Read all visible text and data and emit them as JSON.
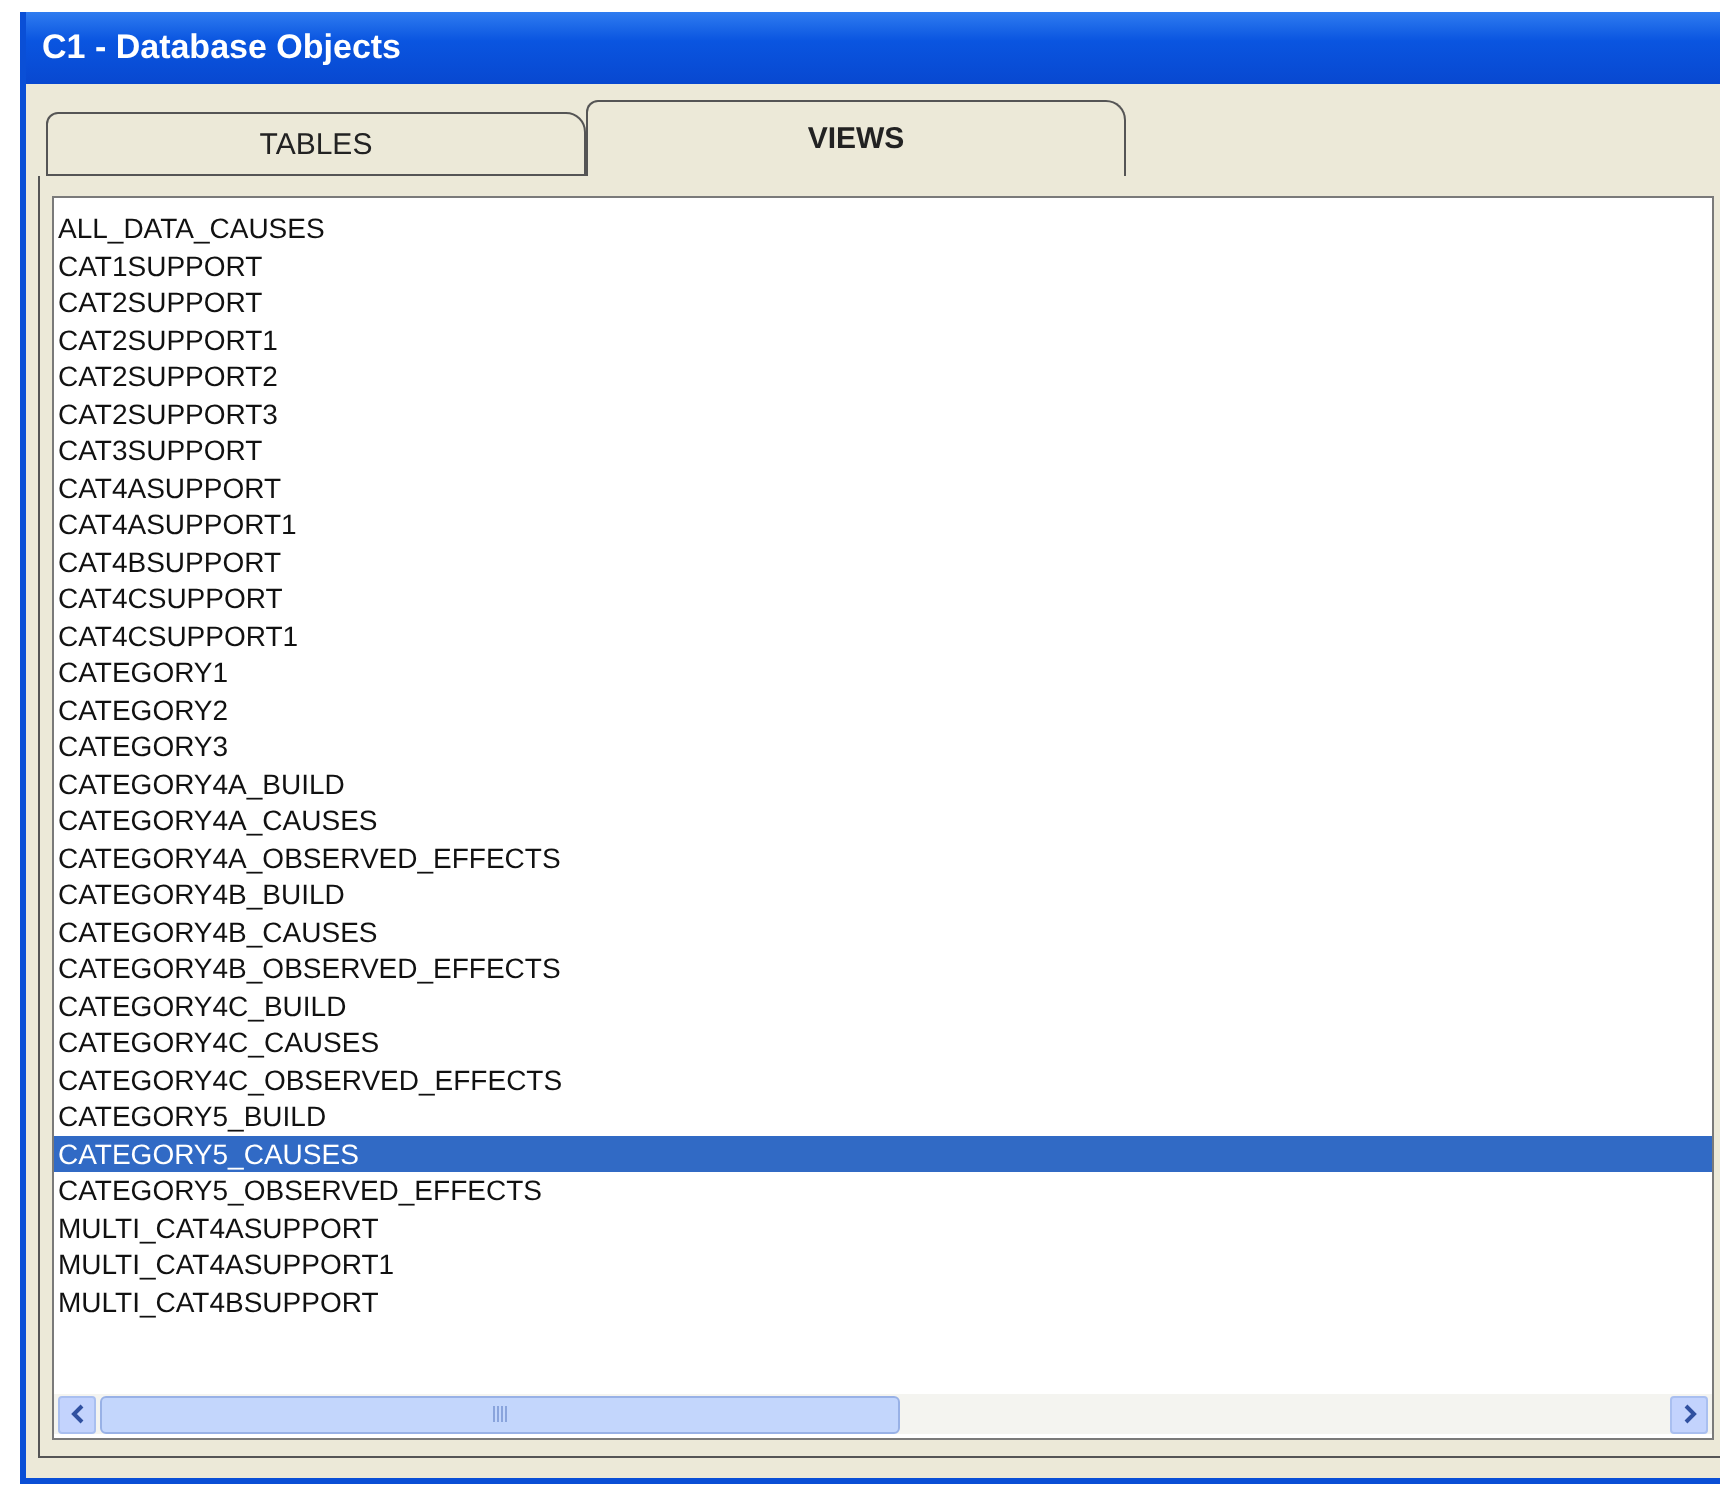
{
  "window": {
    "title": "C1 - Database Objects"
  },
  "tabs": [
    {
      "label": "TABLES",
      "selected": false
    },
    {
      "label": "VIEWS",
      "selected": true
    }
  ],
  "list": {
    "items": [
      {
        "label": "ALL_DATA_CAUSES",
        "selected": false
      },
      {
        "label": "CAT1SUPPORT",
        "selected": false
      },
      {
        "label": "CAT2SUPPORT",
        "selected": false
      },
      {
        "label": "CAT2SUPPORT1",
        "selected": false
      },
      {
        "label": "CAT2SUPPORT2",
        "selected": false
      },
      {
        "label": "CAT2SUPPORT3",
        "selected": false
      },
      {
        "label": "CAT3SUPPORT",
        "selected": false
      },
      {
        "label": "CAT4ASUPPORT",
        "selected": false
      },
      {
        "label": "CAT4ASUPPORT1",
        "selected": false
      },
      {
        "label": "CAT4BSUPPORT",
        "selected": false
      },
      {
        "label": "CAT4CSUPPORT",
        "selected": false
      },
      {
        "label": "CAT4CSUPPORT1",
        "selected": false
      },
      {
        "label": "CATEGORY1",
        "selected": false
      },
      {
        "label": "CATEGORY2",
        "selected": false
      },
      {
        "label": "CATEGORY3",
        "selected": false
      },
      {
        "label": "CATEGORY4A_BUILD",
        "selected": false
      },
      {
        "label": "CATEGORY4A_CAUSES",
        "selected": false
      },
      {
        "label": "CATEGORY4A_OBSERVED_EFFECTS",
        "selected": false
      },
      {
        "label": "CATEGORY4B_BUILD",
        "selected": false
      },
      {
        "label": "CATEGORY4B_CAUSES",
        "selected": false
      },
      {
        "label": "CATEGORY4B_OBSERVED_EFFECTS",
        "selected": false
      },
      {
        "label": "CATEGORY4C_BUILD",
        "selected": false
      },
      {
        "label": "CATEGORY4C_CAUSES",
        "selected": false
      },
      {
        "label": "CATEGORY4C_OBSERVED_EFFECTS",
        "selected": false
      },
      {
        "label": "CATEGORY5_BUILD",
        "selected": false
      },
      {
        "label": "CATEGORY5_CAUSES",
        "selected": true
      },
      {
        "label": "CATEGORY5_OBSERVED_EFFECTS",
        "selected": false
      },
      {
        "label": "MULTI_CAT4ASUPPORT",
        "selected": false
      },
      {
        "label": "MULTI_CAT4ASUPPORT1",
        "selected": false
      },
      {
        "label": "MULTI_CAT4BSUPPORT",
        "selected": false
      }
    ]
  }
}
